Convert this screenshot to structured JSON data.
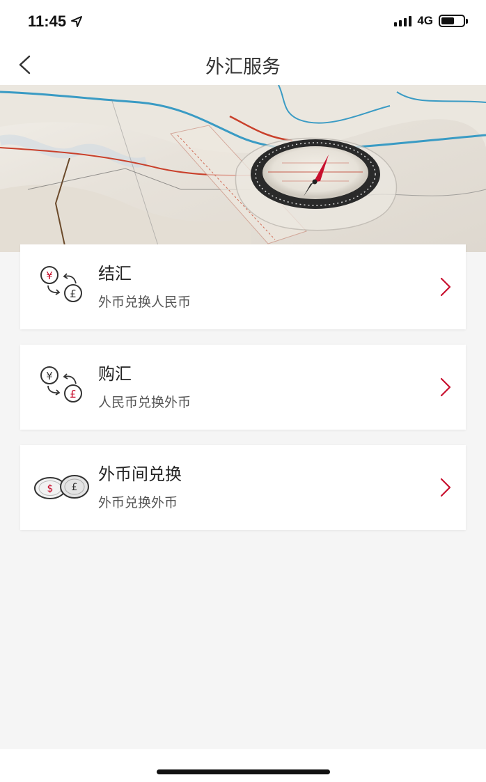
{
  "status_bar": {
    "time": "11:45",
    "network": "4G",
    "battery_level": 0.6
  },
  "header": {
    "title": "外汇服务",
    "back_icon": "chevron-left-icon"
  },
  "banner": {
    "image": "map-with-compass"
  },
  "services": [
    {
      "title": "结汇",
      "subtitle": "外币兑换人民币",
      "icon": "yuan-to-pound-exchange-icon"
    },
    {
      "title": "购汇",
      "subtitle": "人民币兑换外币",
      "icon": "yuan-to-pound-purchase-icon"
    },
    {
      "title": "外币间兑换",
      "subtitle": "外币兑换外币",
      "icon": "dollar-pound-coins-icon"
    }
  ],
  "colors": {
    "accent": "#c8102e",
    "background": "#f5f5f5",
    "card": "#ffffff"
  }
}
